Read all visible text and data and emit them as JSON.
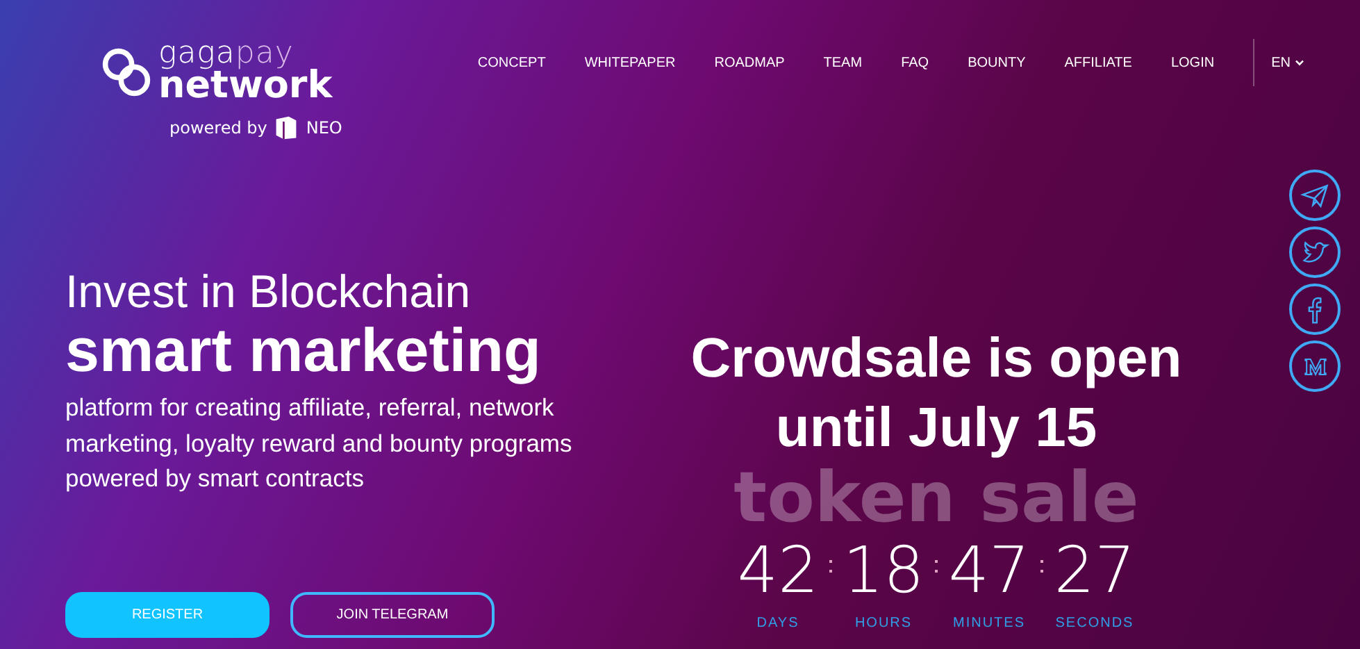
{
  "logo": {
    "brand_first": "gaga",
    "brand_second": "pay",
    "brand_line2": "network",
    "powered_by": "powered by",
    "partner": "NEO"
  },
  "nav": {
    "items": [
      {
        "label": "CONCEPT"
      },
      {
        "label": "WHITEPAPER"
      },
      {
        "label": "ROADMAP"
      },
      {
        "label": "TEAM"
      },
      {
        "label": "FAQ"
      },
      {
        "label": "BOUNTY"
      },
      {
        "label": "AFFILIATE"
      },
      {
        "label": "LOGIN"
      }
    ],
    "language": "EN"
  },
  "hero": {
    "headline_light": "Invest in Blockchain",
    "headline_bold": "smart marketing",
    "description": "platform for creating affiliate, referral, network marketing, loyalty reward and bounty programs powered by smart contracts",
    "buttons": [
      {
        "label": "REGISTER",
        "kind": "filled"
      },
      {
        "label": "JOIN TELEGRAM",
        "kind": "outline"
      }
    ]
  },
  "crowdsale": {
    "title": "Crowdsale is open until July 15",
    "backdrop": "token sale",
    "countdown": [
      {
        "value": "42",
        "unit": "DAYS"
      },
      {
        "value": "18",
        "unit": "HOURS"
      },
      {
        "value": "47",
        "unit": "MINUTES"
      },
      {
        "value": "27",
        "unit": "SECONDS"
      }
    ]
  },
  "social": [
    {
      "kind": "telegram"
    },
    {
      "kind": "twitter"
    },
    {
      "kind": "facebook"
    },
    {
      "kind": "medium"
    }
  ]
}
